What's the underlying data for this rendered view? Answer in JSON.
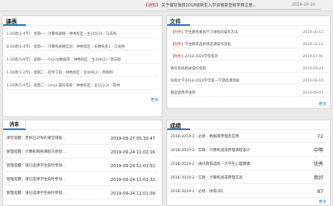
{
  "topbar": {
    "notice_tag": "【通知】",
    "notice_text": "关于做好我校2018级新生入学资格复查和学籍注册...",
    "date": "2019-10-10"
  },
  "course": {
    "title": "课表",
    "rows": [
      "1-16周(1-4节) - 星期一 - 计算机网络 - 钟秀校区 - 主205(2) - 马海燕",
      "8-16周(1-4节) - 星期一 - 计算机网络实验 - 钟秀校区 - 东楼机房1 - 马海燕",
      "1-16周(5-6节) - 星期一 - Oracle数据库 - 钟秀校区 - 主304(2) - 郭志刚",
      "1-16周(1-2节) - 星期二 - 软件工程 - 钟秀校区 - 主409(2) - 周利明",
      "1-16周(5-6节) - 星期二 - Linux 操作系统 - 钟秀校区 - 主311(2) - 陈林"
    ],
    "more": "更多"
  },
  "files": {
    "title": "文件",
    "rows": [
      {
        "tag": "【附件】",
        "text": "学生教育素质学习课程的操作方法",
        "date": "2019-10-12"
      },
      {
        "tag": "【附件】",
        "text": "学生教育选修课选课操作流程",
        "date": "2019-10-12"
      },
      {
        "tag": "【附件】",
        "text": "2018-2020学年校历",
        "date": "2019-07-01"
      },
      {
        "tag": "",
        "text": "教务系统相关操作指南",
        "date": "2019-09-24"
      },
      {
        "tag": "",
        "text": "海南大学2018-2020学年第一学期选课须知",
        "date": "2019-09-10"
      },
      {
        "tag": "",
        "text": "教室使用申请单",
        "date": "2019-09-03"
      }
    ],
    "more": "更多"
  },
  "messages": {
    "title": "消息",
    "more": "更多",
    "rows": [
      {
        "text": "课堂提醒：老师已对你的课堂请假...",
        "time": "2019-09-27 05:30:47"
      },
      {
        "text": "管理提醒：计算机网络课程已更新...",
        "time": "2019-09-24 11:02:16"
      },
      {
        "text": "管理提醒：请已选课学生按时参加...",
        "time": "2019-09-24 11:01:52"
      },
      {
        "text": "管理提醒：请已选课学生按时参加...",
        "time": "2019-09-24 11:01:32"
      },
      {
        "text": "管理提醒：请已选课学生按时参加...",
        "time": "2019-09-24 11:01:09"
      }
    ]
  },
  "grades": {
    "title": "成绩",
    "rows": [
      {
        "text": "2018-2019-2 - 必修 - 数据库原理及应用",
        "score": "72"
      },
      {
        "text": "2018-2019-2 - 实践 - 计算机组成原理课程设计",
        "score": "中等"
      },
      {
        "text": "2018-2019-2 - 通识教育选修 - 大学生心理健康",
        "score": "优秀"
      },
      {
        "text": "2018-2019-2 - 实践 - 计算机组成原理实验",
        "score": "良好"
      },
      {
        "text": "2018-2019-2 - 必修 - 体育(四)",
        "score": "87"
      }
    ],
    "more": "更多"
  }
}
